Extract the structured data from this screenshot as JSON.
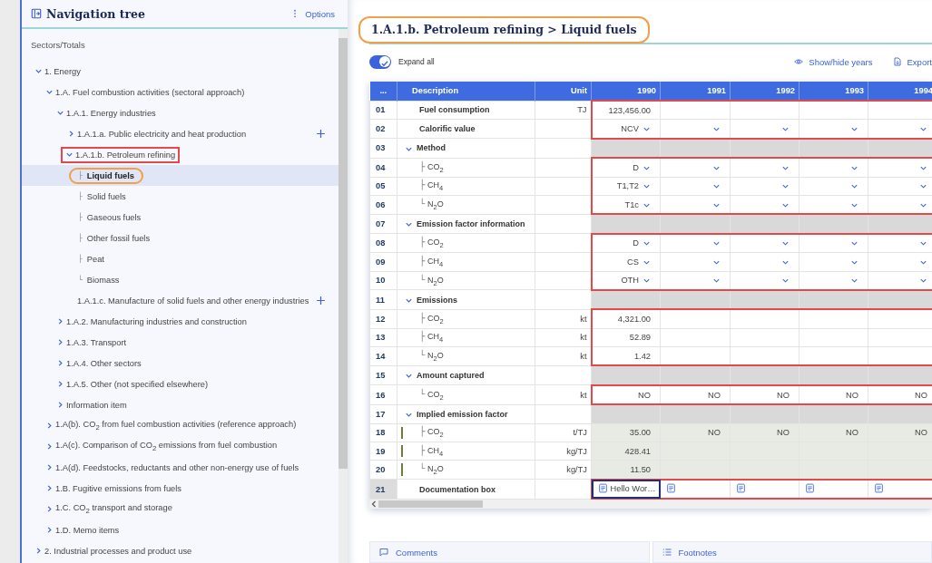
{
  "nav": {
    "title": "Navigation tree",
    "options": "Options",
    "section_label": "Sectors/Totals",
    "tree": [
      {
        "label": "1. Energy",
        "kind": "folder",
        "expanded": true,
        "children": [
          {
            "label": "1.A. Fuel combustion activities (sectoral approach)",
            "kind": "folder",
            "expanded": true,
            "children": [
              {
                "label": "1.A.1. Energy industries",
                "kind": "folder",
                "expanded": true,
                "children": [
                  {
                    "label": "1.A.1.a. Public electricity and heat production",
                    "kind": "folder",
                    "expanded": false,
                    "addable": true
                  },
                  {
                    "label": "1.A.1.b. Petroleum refining",
                    "kind": "folder",
                    "expanded": true,
                    "boxed": true,
                    "children": [
                      {
                        "label": "Liquid fuels",
                        "kind": "leaf",
                        "branch": "├",
                        "selected": true,
                        "circled": true
                      },
                      {
                        "label": "Solid fuels",
                        "kind": "leaf",
                        "branch": "├",
                        "selected": false
                      },
                      {
                        "label": "Gaseous fuels",
                        "kind": "leaf",
                        "branch": "├",
                        "selected": false
                      },
                      {
                        "label": "Other fossil fuels",
                        "kind": "leaf",
                        "branch": "├",
                        "selected": false
                      },
                      {
                        "label": "Peat",
                        "kind": "leaf",
                        "branch": "├",
                        "selected": false
                      },
                      {
                        "label": "Biomass",
                        "kind": "leaf",
                        "branch": "└",
                        "selected": false
                      }
                    ]
                  },
                  {
                    "label": "1.A.1.c. Manufacture of solid fuels and other energy industries",
                    "kind": "plain",
                    "addable": true
                  }
                ]
              },
              {
                "label": "1.A.2. Manufacturing industries and construction",
                "kind": "folder",
                "expanded": false
              },
              {
                "label": "1.A.3. Transport",
                "kind": "folder",
                "expanded": false
              },
              {
                "label": "1.A.4. Other sectors",
                "kind": "folder",
                "expanded": false
              },
              {
                "label": "1.A.5. Other (not specified elsewhere)",
                "kind": "folder",
                "expanded": false
              },
              {
                "label": "Information item",
                "kind": "folder",
                "expanded": false
              }
            ]
          },
          {
            "label": "1.A(b). CO$_{2}$ from fuel combustion activities (reference approach)",
            "kind": "folder",
            "expanded": false
          },
          {
            "label": "1.A(c). Comparison of CO$_{2}$ emissions from fuel combustion",
            "kind": "folder",
            "expanded": false
          },
          {
            "label": "1.A(d). Feedstocks, reductants and other non-energy use of fuels",
            "kind": "folder",
            "expanded": false
          },
          {
            "label": "1.B. Fugitive emissions from fuels",
            "kind": "folder",
            "expanded": false
          },
          {
            "label": "1.C. CO$_{2}$ transport and storage",
            "kind": "folder",
            "expanded": false
          },
          {
            "label": "1.D. Memo items",
            "kind": "folder",
            "expanded": false
          }
        ]
      },
      {
        "label": "2. Industrial processes and product use",
        "kind": "folder",
        "expanded": false
      }
    ]
  },
  "main": {
    "title": {
      "text": "1.A.1.b. Petroleum refining > Liquid fuels",
      "circled": true
    },
    "expand_all": {
      "label": "Expand all",
      "on": true
    },
    "actions": [
      {
        "label": "Show/hide years",
        "kind": "eye"
      },
      {
        "label": "Export",
        "kind": "export"
      }
    ],
    "table": {
      "columns": [
        "...",
        "Description",
        "Unit",
        "1990",
        "1991",
        "1992",
        "1993",
        "1994"
      ],
      "rows": [
        {
          "no": "01",
          "description": "Fuel consumption",
          "unit": "TJ",
          "kind": "value",
          "boxed": true,
          "cells": [
            "123,456.00"
          ]
        },
        {
          "no": "02",
          "description": "Calorific value",
          "kind": "select",
          "boxed": true,
          "cells": [
            "NCV"
          ]
        },
        {
          "no": "03",
          "description": "Method",
          "kind": "section",
          "expanded": true,
          "boxed": false
        },
        {
          "no": "04",
          "description": "CO$_{2}$",
          "branch": "├",
          "kind": "select",
          "boxed": true,
          "cells": [
            "D"
          ]
        },
        {
          "no": "05",
          "description": "CH$_{4}$",
          "branch": "├",
          "kind": "select",
          "boxed": true,
          "cells": [
            "T1,T2"
          ]
        },
        {
          "no": "06",
          "description": "N$_{2}$O",
          "branch": "└",
          "kind": "select",
          "boxed": true,
          "cells": [
            "T1c"
          ]
        },
        {
          "no": "07",
          "description": "Emission factor information",
          "kind": "section",
          "expanded": true,
          "boxed": false
        },
        {
          "no": "08",
          "description": "CO$_{2}$",
          "branch": "├",
          "kind": "select",
          "boxed": true,
          "cells": [
            "D"
          ]
        },
        {
          "no": "09",
          "description": "CH$_{4}$",
          "branch": "├",
          "kind": "select",
          "boxed": true,
          "cells": [
            "CS"
          ]
        },
        {
          "no": "10",
          "description": "N$_{2}$O",
          "branch": "└",
          "kind": "select",
          "boxed": true,
          "cells": [
            "OTH"
          ]
        },
        {
          "no": "11",
          "description": "Emissions",
          "kind": "section",
          "expanded": true,
          "boxed": false
        },
        {
          "no": "12",
          "description": "CO$_{2}$",
          "branch": "├",
          "unit": "kt",
          "kind": "value",
          "boxed": true,
          "cells": [
            "4,321.00"
          ]
        },
        {
          "no": "13",
          "description": "CH$_{4}$",
          "branch": "├",
          "unit": "kt",
          "kind": "value",
          "boxed": true,
          "cells": [
            "52.89"
          ]
        },
        {
          "no": "14",
          "description": "N$_{2}$O",
          "branch": "└",
          "unit": "kt",
          "kind": "value",
          "boxed": true,
          "cells": [
            "1.42"
          ]
        },
        {
          "no": "15",
          "description": "Amount captured",
          "kind": "section",
          "expanded": true,
          "boxed": false
        },
        {
          "no": "16",
          "description": "CO$_{2}$",
          "branch": "└",
          "unit": "kt",
          "kind": "value",
          "boxed": true,
          "cells": [
            "NO",
            "NO",
            "NO",
            "NO",
            "NO"
          ]
        },
        {
          "no": "17",
          "description": "Implied emission factor",
          "kind": "section",
          "expanded": true,
          "boxed": false
        },
        {
          "no": "18",
          "description": "CO$_{2}$",
          "branch": "├",
          "unit": "t/TJ",
          "kind": "computed",
          "boxed": false,
          "cells": [
            "35.00",
            "NO",
            "NO",
            "NO",
            "NO"
          ]
        },
        {
          "no": "19",
          "description": "CH$_{4}$",
          "branch": "├",
          "unit": "kg/TJ",
          "kind": "computed",
          "boxed": false,
          "cells": [
            "428.41"
          ]
        },
        {
          "no": "20",
          "description": "N$_{2}$O",
          "branch": "└",
          "unit": "kg/TJ",
          "kind": "computed",
          "boxed": false,
          "cells": [
            "11.50"
          ]
        },
        {
          "no": "21",
          "description": "Documentation box",
          "kind": "doc",
          "boxed": true,
          "selected": true,
          "cells": [
            {
              "text": "Hello Wor…",
              "selected": true
            },
            {
              "selected": false
            },
            {
              "selected": false
            },
            {
              "selected": false
            },
            {
              "selected": false
            }
          ]
        }
      ]
    }
  },
  "panels": [
    {
      "label": "Comments",
      "kind": "comments"
    },
    {
      "label": "Footnotes",
      "kind": "footnotes"
    }
  ]
}
